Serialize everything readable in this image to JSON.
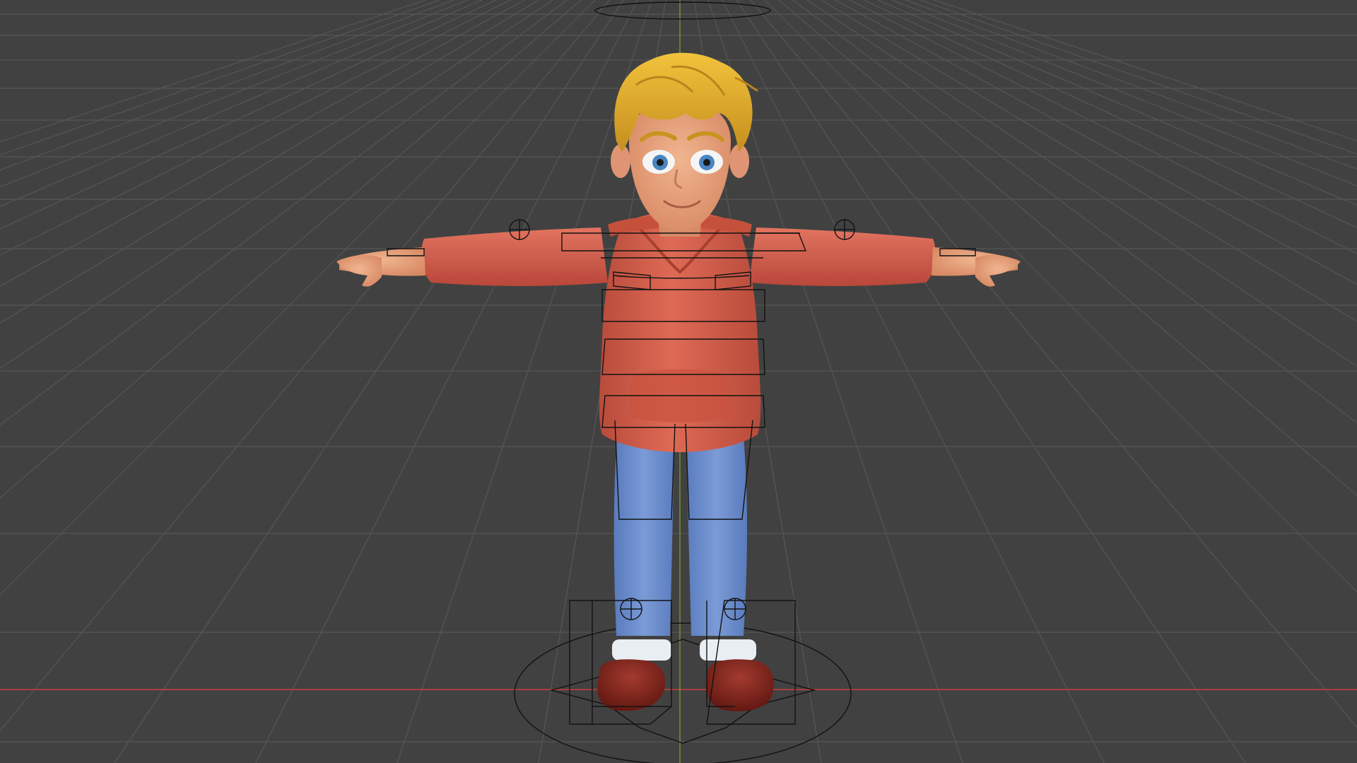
{
  "viewport": {
    "mode": "3d-viewport",
    "shading": "solid",
    "colors": {
      "background": "#414141",
      "grid_line": "#555555",
      "x_axis": "#c8403a",
      "z_axis": "#7aa62a",
      "rig_wire": "#111111",
      "hoodie": "#d8624f",
      "hoodie_shadow": "#b4493a",
      "jeans": "#6b8cc8",
      "jeans_shadow": "#5273b0",
      "skin": "#e9a37c",
      "hair": "#e3b22c",
      "hair_shadow": "#b9851c",
      "shoes": "#7a1f17",
      "socks": "#e9eef2",
      "eyes": "#4a86c0"
    }
  },
  "scene": {
    "object": "character",
    "pose": "T-pose",
    "outfit": [
      "hoodie",
      "jeans",
      "shoes"
    ],
    "rig": "armature-controls-visible"
  }
}
